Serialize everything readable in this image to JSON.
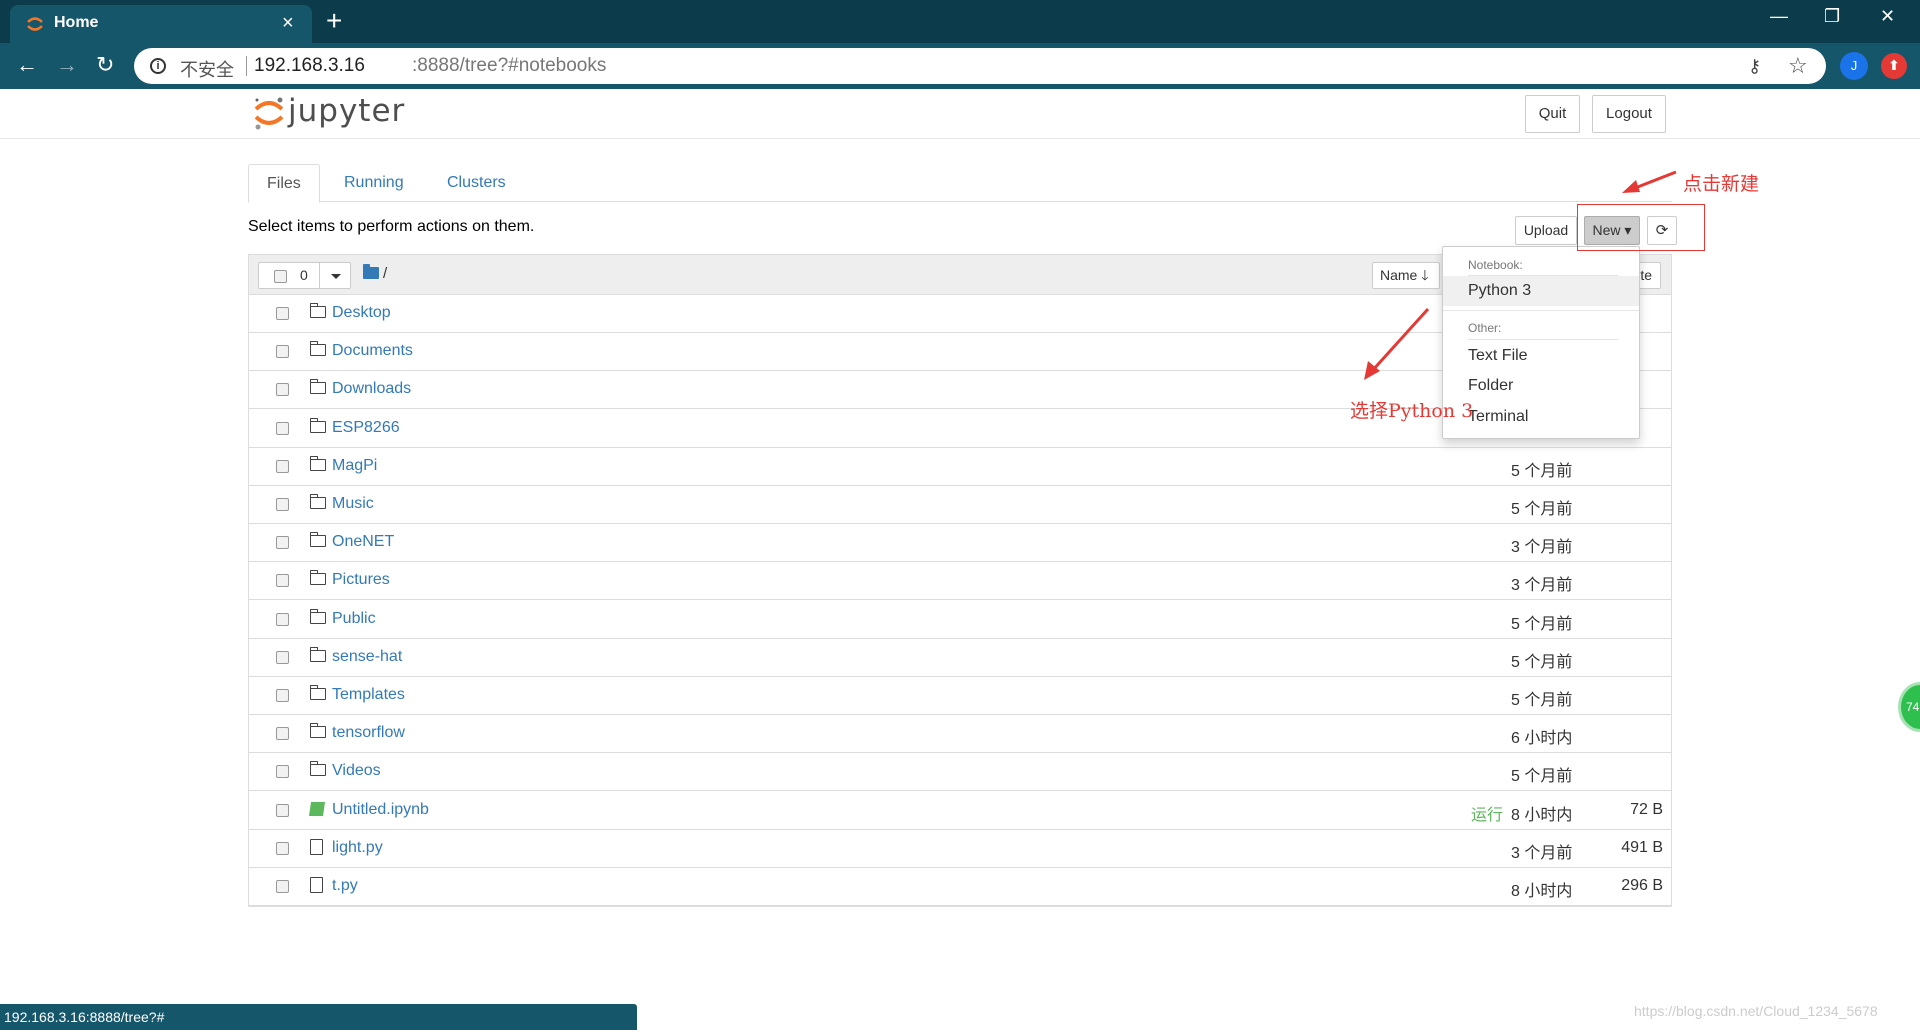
{
  "browser": {
    "tab_title": "Home",
    "tab_close": "×",
    "new_tab": "+",
    "insecure_label": "不安全",
    "url_host": "192.168.3.16",
    "url_rest": ":8888/tree?#notebooks",
    "profile_initial": "J",
    "window_controls": [
      "—",
      "❐",
      "✕"
    ]
  },
  "header": {
    "logo_text": "jupyter",
    "quit_label": "Quit",
    "logout_label": "Logout"
  },
  "tabs": [
    "Files",
    "Running",
    "Clusters"
  ],
  "toolbar": {
    "hint": "Select items to perform actions on them.",
    "upload_label": "Upload",
    "new_label": "New ▾",
    "refresh_icon": "⟳"
  },
  "annotations": {
    "click_new": "点击新建",
    "select_python": "选择Python 3"
  },
  "list_header": {
    "selected_count": "0",
    "root": "/",
    "sort_name": "Name 🡓",
    "sort_last_modified": "te"
  },
  "dropdown": {
    "notebook_header": "Notebook:",
    "python3": "Python 3",
    "other_header": "Other:",
    "text_file": "Text File",
    "folder": "Folder",
    "terminal": "Terminal"
  },
  "files": [
    {
      "name": "Desktop",
      "type": "folder",
      "time": "",
      "size": "",
      "running": ""
    },
    {
      "name": "Documents",
      "type": "folder",
      "time": "",
      "size": "",
      "running": ""
    },
    {
      "name": "Downloads",
      "type": "folder",
      "time": "",
      "size": "",
      "running": ""
    },
    {
      "name": "ESP8266",
      "type": "folder",
      "time": "",
      "size": "",
      "running": ""
    },
    {
      "name": "MagPi",
      "type": "folder",
      "time": "5 个月前",
      "size": "",
      "running": ""
    },
    {
      "name": "Music",
      "type": "folder",
      "time": "5 个月前",
      "size": "",
      "running": ""
    },
    {
      "name": "OneNET",
      "type": "folder",
      "time": "3 个月前",
      "size": "",
      "running": ""
    },
    {
      "name": "Pictures",
      "type": "folder",
      "time": "3 个月前",
      "size": "",
      "running": ""
    },
    {
      "name": "Public",
      "type": "folder",
      "time": "5 个月前",
      "size": "",
      "running": ""
    },
    {
      "name": "sense-hat",
      "type": "folder",
      "time": "5 个月前",
      "size": "",
      "running": ""
    },
    {
      "name": "Templates",
      "type": "folder",
      "time": "5 个月前",
      "size": "",
      "running": ""
    },
    {
      "name": "tensorflow",
      "type": "folder",
      "time": "6 小时内",
      "size": "",
      "running": ""
    },
    {
      "name": "Videos",
      "type": "folder",
      "time": "5 个月前",
      "size": "",
      "running": ""
    },
    {
      "name": "Untitled.ipynb",
      "type": "notebook",
      "time": "8 小时内",
      "size": "72 B",
      "running": "运行"
    },
    {
      "name": "light.py",
      "type": "file",
      "time": "3 个月前",
      "size": "491 B",
      "running": ""
    },
    {
      "name": "t.py",
      "type": "file",
      "time": "8 小时内",
      "size": "296 B",
      "running": ""
    }
  ],
  "status_url": "192.168.3.16:8888/tree?#",
  "watermark": "https://blog.csdn.net/Cloud_1234_5678",
  "side_badge": "74"
}
